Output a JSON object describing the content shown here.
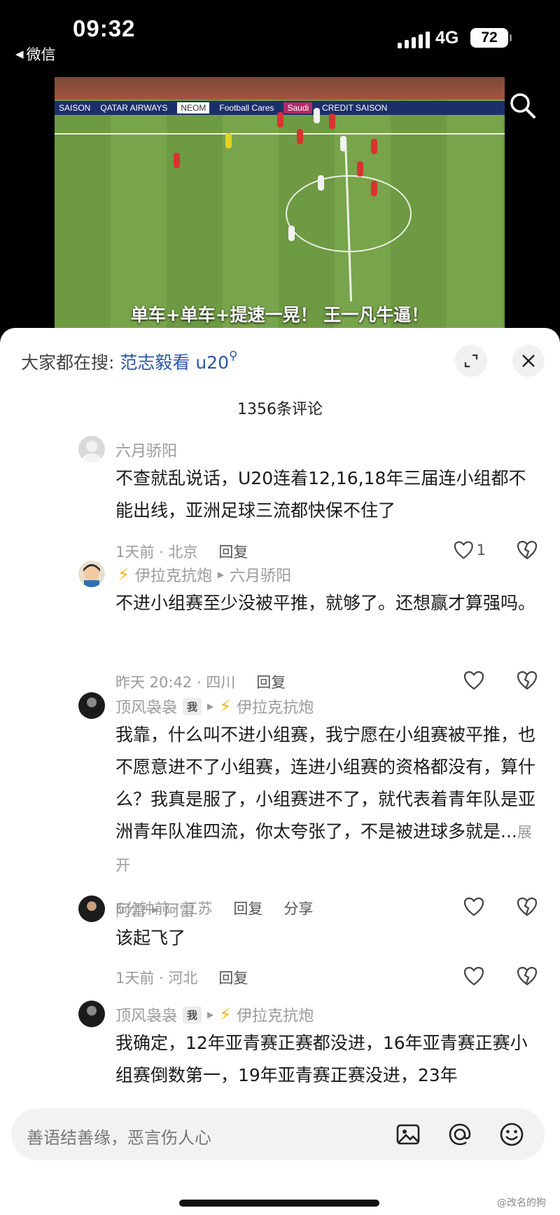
{
  "status_bar": {
    "time": "09:32",
    "back_app": "微信",
    "network": "4G",
    "battery": "72"
  },
  "video": {
    "subtitle": "单车+单车+提速一晃！ 王一凡牛逼！",
    "ads": [
      "SAISON",
      "QATAR AIRWAYS",
      "NEOM",
      "Football Cares",
      "Saudi",
      "CREDIT SAISON"
    ]
  },
  "panel": {
    "trending_prefix": "大家都在搜:",
    "trending_keyword": "范志毅看 u20",
    "comment_count": "1356条评论"
  },
  "comments": [
    {
      "user": "六月骄阳",
      "text": "不查就乱说话，U20连着12,16,18年三届连小组都不能出线，亚洲足球三流都快保不住了",
      "time_loc": "1天前 · 北京",
      "reply": "回复",
      "likes": "1"
    },
    {
      "user": "伊拉克抗炮",
      "reply_to": "六月骄阳",
      "text": "不进小组赛至少没被平推，就够了。还想赢才算强吗。",
      "time_loc": "昨天 20:42 · 四川",
      "reply": "回复"
    },
    {
      "user": "顶风袅袅",
      "me_tag": "我",
      "reply_to": "伊拉克抗炮",
      "text": "我靠，什么叫不进小组赛，我宁愿在小组赛被平推，也不愿意进不了小组赛，连进小组赛的资格都没有，算什么？我真是服了，小组赛进不了，就代表着青年队是亚洲青年队准四流，你太夸张了，不是被进球多就是...",
      "more": "展开",
      "time_loc": "6分钟前 · 江苏",
      "reply": "回复",
      "share": "分享"
    },
    {
      "user": "阿雷",
      "reply_to": "阿雷",
      "text": "该起飞了",
      "time_loc": "1天前 · 河北",
      "reply": "回复"
    },
    {
      "user": "顶风袅袅",
      "me_tag": "我",
      "reply_to": "伊拉克抗炮",
      "text": "我确定，12年亚青赛正赛都没进，16年亚青赛正赛小组赛倒数第一，19年亚青赛正赛没进，23年"
    }
  ],
  "input": {
    "placeholder": "善语结善缘，恶言伤人心"
  },
  "watermark": "@改名的狗"
}
